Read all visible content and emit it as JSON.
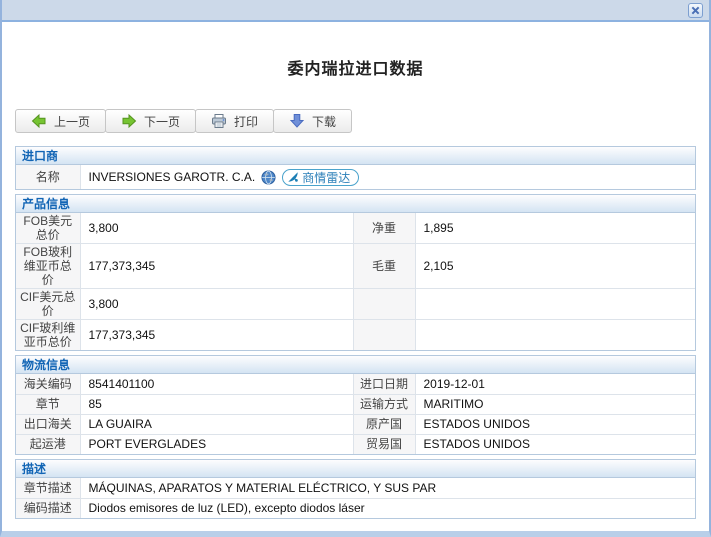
{
  "page_title": "委内瑞拉进口数据",
  "window": {
    "close_icon": "x-close"
  },
  "toolbar": {
    "prev_label": "上一页",
    "next_label": "下一页",
    "print_label": "打印",
    "download_label": "下载",
    "icons": [
      "green-arrow-left-icon",
      "green-arrow-right-icon",
      "printer-icon",
      "blue-arrow-down-icon"
    ]
  },
  "sections": {
    "importer": {
      "header": "进口商",
      "rows": [
        {
          "label": "名称",
          "value": "INVERSIONES GAROTR. C.A."
        }
      ],
      "globe_icon": "globe-icon",
      "radar_icon": "satellite-dish-icon",
      "radar_label": "商情雷达"
    },
    "product": {
      "header": "产品信息",
      "rows": [
        {
          "label": "FOB美元总价",
          "value": "3,800",
          "label2": "净重",
          "value2": "1,895"
        },
        {
          "label": "FOB玻利维亚币总价",
          "value": "177,373,345",
          "label2": "毛重",
          "value2": "2,105"
        },
        {
          "label": "CIF美元总价",
          "value": "3,800",
          "label2": "",
          "value2": ""
        },
        {
          "label": "CIF玻利维亚币总价",
          "value": "177,373,345",
          "label2": "",
          "value2": ""
        }
      ]
    },
    "logistics": {
      "header": "物流信息",
      "rows": [
        {
          "label": "海关编码",
          "value": "8541401100",
          "label2": "进口日期",
          "value2": "2019-12-01"
        },
        {
          "label": "章节",
          "value": "85",
          "label2": "运输方式",
          "value2": "MARITIMO"
        },
        {
          "label": "出口海关",
          "value": "LA GUAIRA",
          "label2": "原产国",
          "value2": "ESTADOS UNIDOS"
        },
        {
          "label": "起运港",
          "value": "PORT EVERGLADES",
          "label2": "贸易国",
          "value2": "ESTADOS UNIDOS"
        }
      ]
    },
    "description": {
      "header": "描述",
      "rows": [
        {
          "label": "章节描述",
          "value": "MÁQUINAS, APARATOS Y MATERIAL ELÉCTRICO, Y SUS PAR"
        },
        {
          "label": "编码描述",
          "value": "Diodos emisores de luz (LED), excepto diodos láser"
        }
      ]
    }
  },
  "colors": {
    "titlebar_bg": "#ccd9e9",
    "window_border": "#94b3dd",
    "section_header_text": "#1265b5",
    "section_header_bg": "#d4e4f3",
    "label_cell_bg": "#f6f6f7",
    "badge_blue": "#2b7fb8",
    "arrow_green": "#76c432",
    "arrow_blue": "#6f8fd8"
  }
}
